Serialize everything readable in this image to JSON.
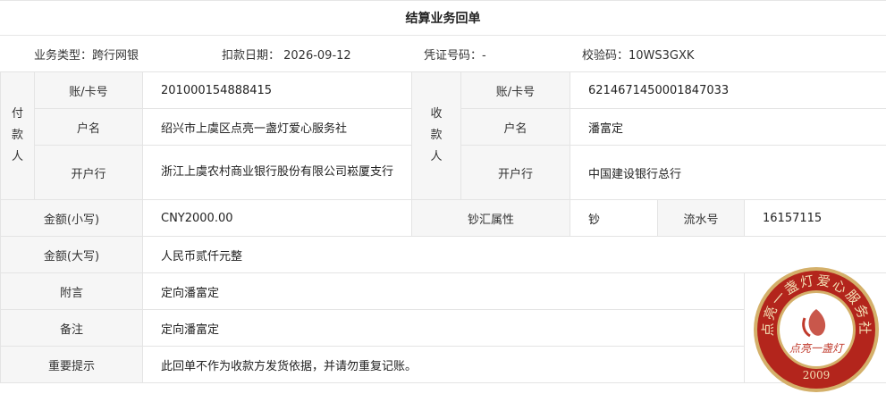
{
  "title": "结算业务回单",
  "meta": {
    "business_type": "业务类型：跨行网银",
    "debit_date": "扣款日期：  2026-09-12",
    "voucher_no": "凭证号码：-",
    "check_code": "校验码：10WS3GXK"
  },
  "payer": {
    "side_label": "付款人",
    "account_label": "账/卡号",
    "account": "201000154888415",
    "name_label": "户名",
    "name": "绍兴市上虞区点亮一盏灯爱心服务社",
    "bank_label": "开户行",
    "bank": "浙江上虞农村商业银行股份有限公司崧厦支行"
  },
  "payee": {
    "side_label": "收款人",
    "account_label": "账/卡号",
    "account": "6214671450001847033",
    "name_label": "户名",
    "name": "潘富定",
    "bank_label": "开户行",
    "bank": "中国建设银行总行"
  },
  "amount": {
    "small_label": "金额(小写)",
    "small": "CNY2000.00",
    "cash_label": "钞汇属性",
    "cash": "钞",
    "serial_label": "流水号",
    "serial": "16157115",
    "big_label": "金额(大写)",
    "big": "人民币贰仟元整"
  },
  "notes": {
    "postscript_label": "附言",
    "postscript": "定向潘富定",
    "remark_label": "备注",
    "remark": "定向潘富定",
    "tip_label": "重要提示",
    "tip": "此回单不作为收款方发货依据，并请勿重复记账。"
  },
  "seal": {
    "ring_text": "点亮一盏灯爱心服务社",
    "inner_text": "点亮一盏灯",
    "year": "2009",
    "colors": {
      "ring": "#b3251c",
      "gold": "#d4b06a",
      "inner": "#c0392b"
    }
  }
}
